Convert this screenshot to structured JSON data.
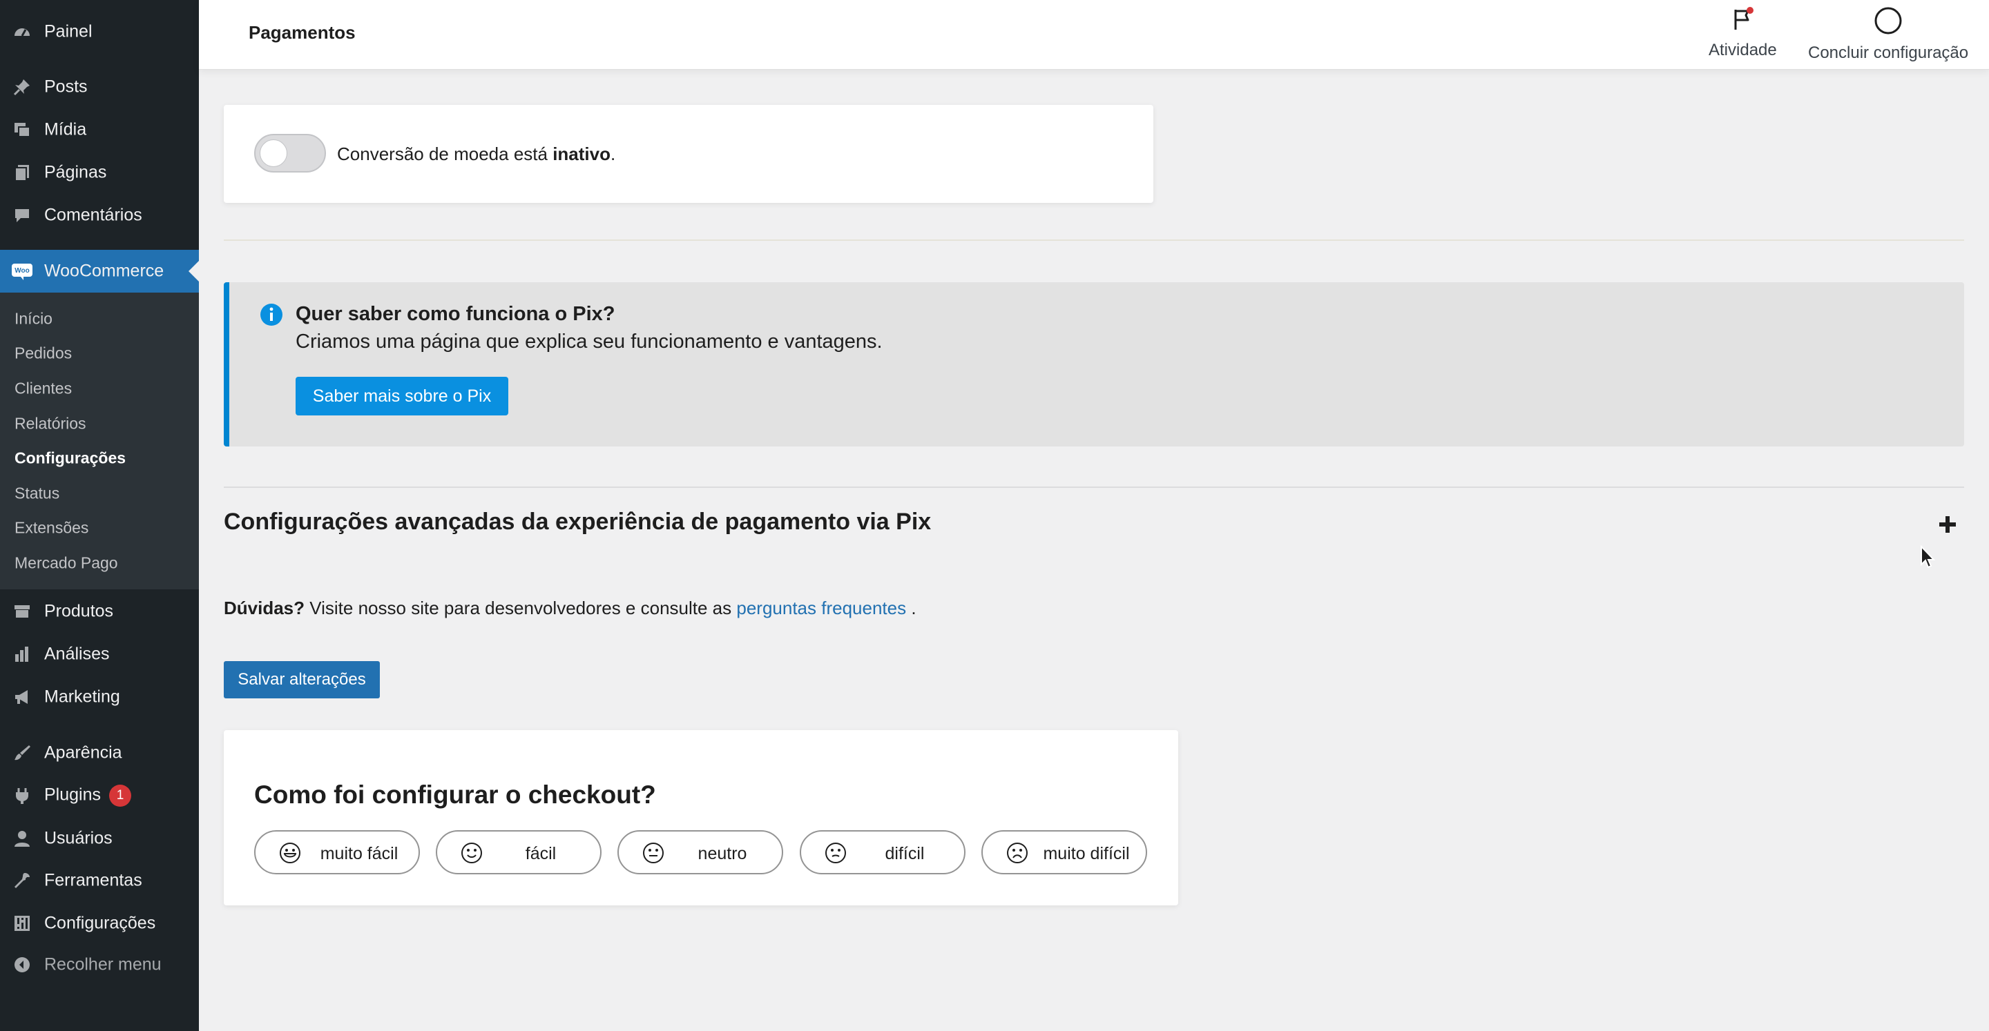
{
  "sidebar": {
    "items": [
      {
        "label": "Painel",
        "icon": "dashboard-icon"
      },
      {
        "label": "Posts",
        "icon": "pin-icon"
      },
      {
        "label": "Mídia",
        "icon": "media-icon"
      },
      {
        "label": "Páginas",
        "icon": "pages-icon"
      },
      {
        "label": "Comentários",
        "icon": "comments-icon"
      },
      {
        "label": "WooCommerce",
        "icon": "woocommerce-icon"
      },
      {
        "label": "Produtos",
        "icon": "products-icon"
      },
      {
        "label": "Análises",
        "icon": "analytics-icon"
      },
      {
        "label": "Marketing",
        "icon": "megaphone-icon"
      },
      {
        "label": "Aparência",
        "icon": "brush-icon"
      },
      {
        "label": "Plugins",
        "icon": "plugin-icon",
        "badge": "1"
      },
      {
        "label": "Usuários",
        "icon": "user-icon"
      },
      {
        "label": "Ferramentas",
        "icon": "wrench-icon"
      },
      {
        "label": "Configurações",
        "icon": "settings-icon"
      },
      {
        "label": "Recolher menu",
        "icon": "collapse-icon"
      }
    ],
    "woocommerce_submenu": [
      "Início",
      "Pedidos",
      "Clientes",
      "Relatórios",
      "Configurações",
      "Status",
      "Extensões",
      "Mercado Pago"
    ],
    "current_submenu": "Configurações"
  },
  "header": {
    "title": "Pagamentos",
    "activity_label": "Atividade",
    "finish_setup_label": "Concluir configuração"
  },
  "currency": {
    "text_prefix": "Conversão de moeda está ",
    "status": "inativo",
    "text_suffix": ".",
    "enabled": false
  },
  "pix_notice": {
    "title": "Quer saber como funciona o Pix?",
    "text": "Criamos uma página que explica seu funcionamento e vantagens.",
    "button_label": "Saber mais sobre o Pix"
  },
  "advanced": {
    "title": "Configurações avançadas da experiência de pagamento via Pix",
    "expand_icon": "plus-icon"
  },
  "faq": {
    "bold": "Dúvidas?",
    "text": " Visite nosso site para desenvolvedores e consulte as ",
    "link": "perguntas frequentes",
    "suffix": " ."
  },
  "save_button_label": "Salvar alterações",
  "survey": {
    "title": "Como foi configurar o checkout?",
    "options": [
      "muito fácil",
      "fácil",
      "neutro",
      "difícil",
      "muito difícil"
    ]
  },
  "colors": {
    "sidebar_bg": "#1d2327",
    "active_blue": "#2271b1",
    "notice_accent": "#0085d1",
    "badge_red": "#d63638"
  }
}
